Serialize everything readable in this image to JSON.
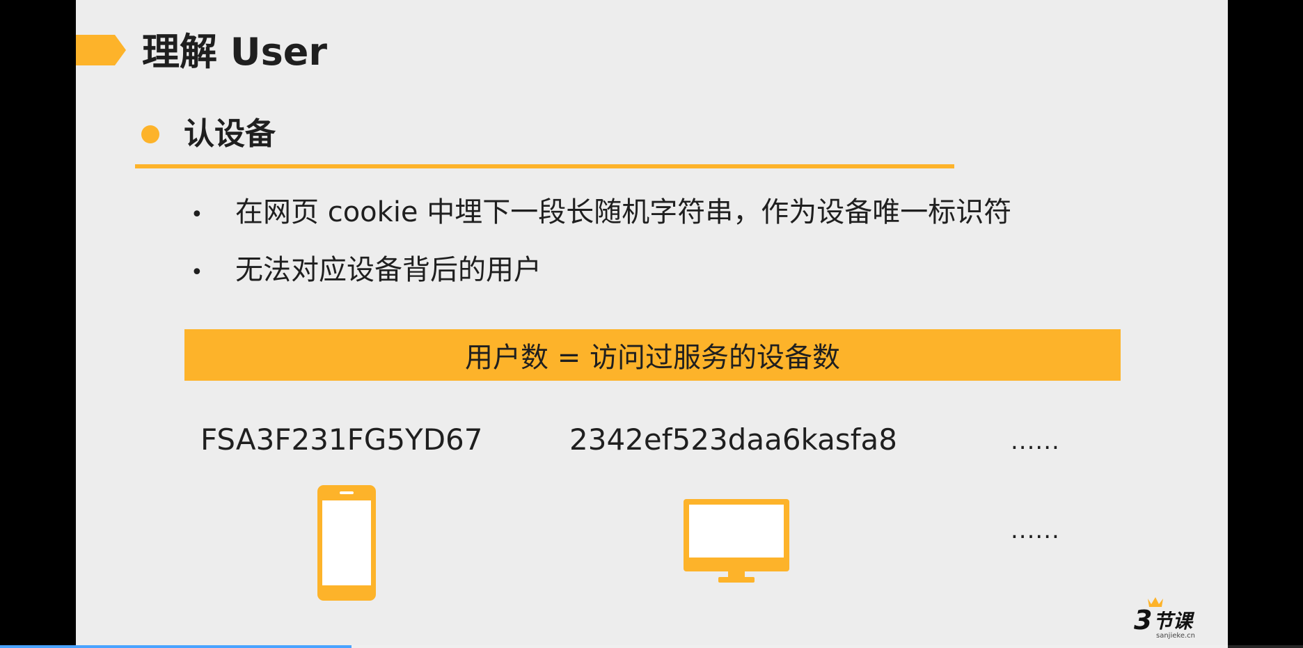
{
  "slide": {
    "title": "理解 User",
    "section": "认设备",
    "bullets": [
      "在网页 cookie 中埋下一段长随机字符串，作为设备唯一标识符",
      "无法对应设备背后的用户"
    ],
    "formula": "用户数 = 访问过服务的设备数",
    "device_ids": [
      "FSA3F231FG5YD67",
      "2342ef523daa6kasfa8"
    ],
    "ellipsis": "......",
    "icons": [
      "phone-icon",
      "monitor-icon"
    ]
  },
  "brand": {
    "name": "3节课",
    "site": "sanjieke.cn"
  },
  "player": {
    "progress_fraction": 0.27
  },
  "colors": {
    "accent": "#fdb32a",
    "slide_background": "#ededed",
    "text": "#1f1f1f",
    "letterbox": "#000000",
    "progress": "#4aa3ff"
  }
}
